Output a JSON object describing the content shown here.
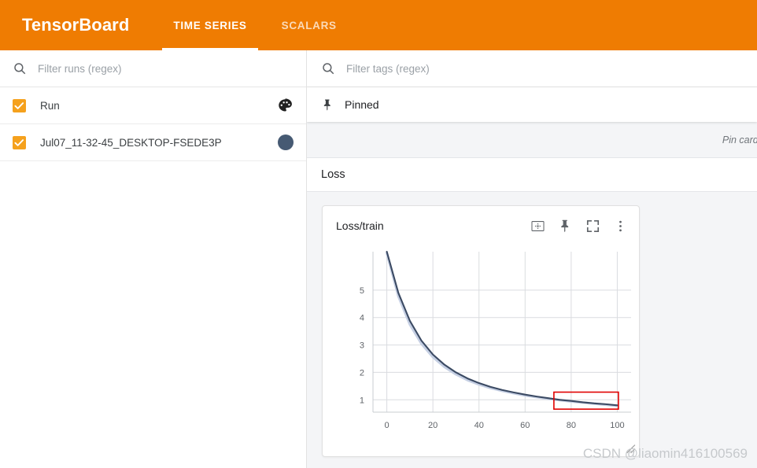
{
  "appbar": {
    "brand": "TensorBoard",
    "tabs": [
      {
        "label": "TIME SERIES",
        "active": true
      },
      {
        "label": "SCALARS",
        "active": false
      }
    ],
    "background_color": "#ef7c02"
  },
  "sidebar": {
    "run_filter_placeholder": "Filter runs (regex)",
    "header_row": {
      "label": "Run",
      "checked": true,
      "icon": "palette-icon"
    },
    "runs": [
      {
        "label": "Jul07_11-32-45_DESKTOP-FSEDE3P",
        "checked": true,
        "color": "#465a73"
      }
    ],
    "checkbox_color": "#f5a11d"
  },
  "main": {
    "tag_filter_placeholder": "Filter tags (regex)",
    "pinned_label": "Pinned",
    "pin_cards_hint": "Pin cards",
    "group_title": "Loss",
    "card": {
      "title": "Loss/train",
      "actions": [
        {
          "name": "data-fit-icon",
          "tooltip": "Fit domain to data"
        },
        {
          "name": "pin-icon",
          "tooltip": "Pin card"
        },
        {
          "name": "fullscreen-icon",
          "tooltip": "Toggle fullscreen"
        },
        {
          "name": "more-options-icon",
          "tooltip": "More options"
        }
      ]
    }
  },
  "watermark": "CSDN @liaomin416100569",
  "chart_data": {
    "type": "line",
    "title": "Loss/train",
    "xlabel": "",
    "ylabel": "",
    "xlim": [
      -6,
      106
    ],
    "ylim": [
      0.55,
      6.4
    ],
    "xticks": [
      0,
      20,
      40,
      60,
      80,
      100
    ],
    "yticks": [
      1,
      2,
      3,
      4,
      5
    ],
    "grid": true,
    "legend": false,
    "series": [
      {
        "name": "Jul07_11-32-45_DESKTOP-FSEDE3P (raw)",
        "color": "#c5cfe3",
        "width": 3.2,
        "x": [
          0,
          5,
          10,
          15,
          20,
          25,
          30,
          35,
          40,
          45,
          50,
          55,
          60,
          65,
          70,
          75,
          80,
          85,
          90,
          95,
          100
        ],
        "values": [
          6.35,
          4.78,
          3.75,
          3.05,
          2.56,
          2.2,
          1.93,
          1.72,
          1.56,
          1.43,
          1.33,
          1.24,
          1.16,
          1.1,
          1.04,
          0.99,
          0.94,
          0.9,
          0.86,
          0.82,
          0.78
        ]
      },
      {
        "name": "Jul07_11-32-45_DESKTOP-FSEDE3P",
        "color": "#3b4a63",
        "width": 2.1,
        "x": [
          0,
          5,
          10,
          15,
          20,
          25,
          30,
          35,
          40,
          45,
          50,
          55,
          60,
          65,
          70,
          75,
          80,
          85,
          90,
          95,
          100
        ],
        "values": [
          6.4,
          4.9,
          3.88,
          3.16,
          2.65,
          2.28,
          2.0,
          1.78,
          1.61,
          1.47,
          1.36,
          1.27,
          1.19,
          1.12,
          1.06,
          1.0,
          0.96,
          0.91,
          0.87,
          0.84,
          0.8
        ]
      }
    ],
    "annotations": [
      {
        "type": "rect",
        "name": "highlight-box",
        "color": "#e00000",
        "x0": 72.5,
        "x1": 100.5,
        "y0": 0.66,
        "y1": 1.28
      }
    ]
  }
}
